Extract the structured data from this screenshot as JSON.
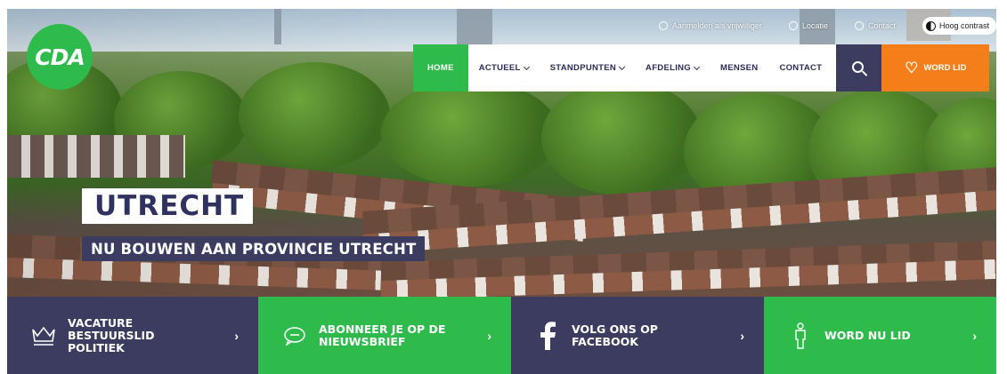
{
  "brand": {
    "logo_text": "CDA",
    "green": "#2ebb4b",
    "navy": "#3b3c5f",
    "orange": "#f47f1a"
  },
  "utility": {
    "volunteer": {
      "label": "Aanmelden als vrijwilliger",
      "icon": "user-icon"
    },
    "location": {
      "label": "Locatie",
      "icon": "pin-icon"
    },
    "contact": {
      "label": "Contact",
      "icon": "phone-icon"
    },
    "contrast": {
      "label": "Hoog contrast",
      "icon": "contrast-icon"
    }
  },
  "nav": {
    "items": [
      {
        "label": "HOME",
        "active": true,
        "dropdown": false
      },
      {
        "label": "ACTUEEL",
        "dropdown": true
      },
      {
        "label": "STANDPUNTEN",
        "dropdown": true
      },
      {
        "label": "AFDELING",
        "dropdown": true
      },
      {
        "label": "MENSEN",
        "dropdown": false
      },
      {
        "label": "CONTACT",
        "dropdown": false
      }
    ],
    "search_icon": "search-icon",
    "join_label": "WORD LID",
    "join_icon": "heart-icon"
  },
  "hero": {
    "title": "UTRECHT",
    "subtitle": "NU BOUWEN AAN PROVINCIE UTRECHT"
  },
  "tiles": [
    {
      "label": "VACATURE BESTUURSLID POLITIEK",
      "icon": "crown-icon",
      "arrow": "›"
    },
    {
      "label": "ABONNEER JE OP DE NIEUWSBRIEF",
      "icon": "chat-icon",
      "arrow": "›"
    },
    {
      "label": "VOLG ONS OP FACEBOOK",
      "icon": "facebook-icon",
      "arrow": "›"
    },
    {
      "label": "WORD NU LID",
      "icon": "person-icon",
      "arrow": "›"
    }
  ]
}
